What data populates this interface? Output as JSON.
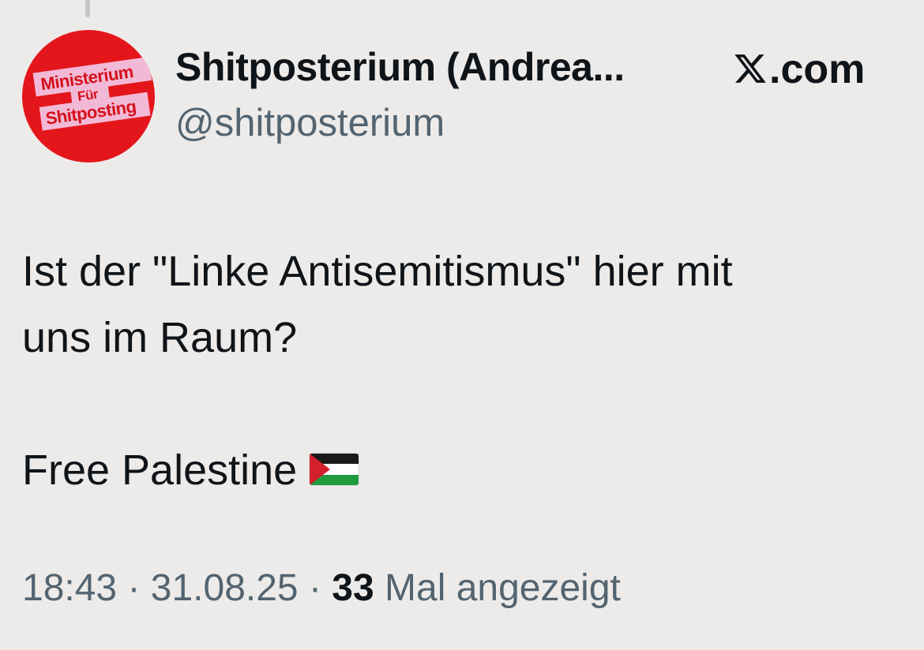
{
  "author": {
    "display_name": "Shitposterium (Andrea...",
    "handle": "@shitposterium",
    "avatar_text": {
      "line1": "Ministerium",
      "line2": "Für",
      "line3": "Shitposting"
    }
  },
  "source": {
    "label": ".com",
    "icon": "x-logo-icon"
  },
  "tweet": {
    "line1": "Ist der \"Linke Antisemitismus\" hier mit",
    "line2": "uns im Raum?",
    "line3": "Free Palestine",
    "emoji": "palestine-flag-icon"
  },
  "meta": {
    "time": "18:43",
    "separator1": " · ",
    "date": "31.08.25",
    "separator2": " · ",
    "views_count": "33",
    "views_label": " Mal angezeigt"
  },
  "colors": {
    "background": "#edebe9",
    "avatar_red": "#e4161b",
    "avatar_pink": "#f2b9d6",
    "text_primary": "#0f1419",
    "text_secondary": "#536471"
  }
}
